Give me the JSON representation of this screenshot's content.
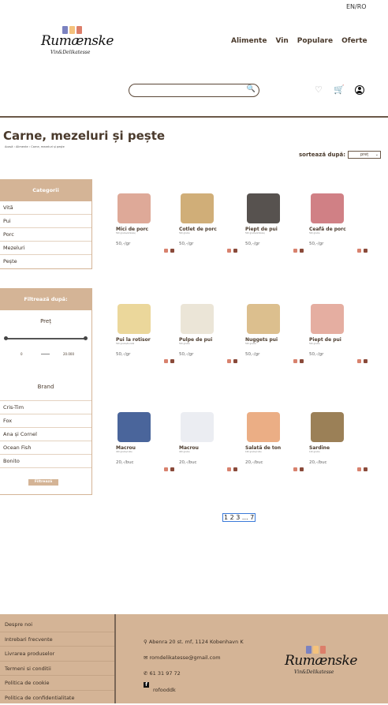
{
  "header": {
    "lang": "EN/RO",
    "logo_name": "Rumænske",
    "logo_sub": "Vin&Delikatesse",
    "nav": [
      "Alimente",
      "Vin",
      "Populare",
      "Oferte"
    ],
    "search_placeholder": "",
    "colors": {
      "bar1": "#7b82c0",
      "bar2": "#f4c27c",
      "bar3": "#dc7e6a",
      "accent": "#d4b496"
    }
  },
  "page": {
    "title": "Carne, mezeluri și pește",
    "breadcrumb": "Acasă › Alimente › Carne, mezeluri și pește",
    "sort_label": "sortează după:",
    "sort_value": "preț"
  },
  "categories": {
    "title": "Categorii",
    "items": [
      "Vită",
      "Pui",
      "Porc",
      "Mezeluri",
      "Pește"
    ]
  },
  "filter": {
    "title": "Filtrează după:",
    "price_label": "Preț",
    "price_min": "0",
    "price_max": "20.000",
    "price_range": [
      0,
      1
    ],
    "brand_label": "Brand",
    "brands": [
      "Cris-Tim",
      "Fox",
      "Ana și Cornel",
      "Ocean Fish",
      "Bonito"
    ],
    "button": "Filtrează"
  },
  "products": [
    {
      "name": "Mici de porc",
      "desc": "500 grame/ambalaj",
      "price": "50,-/gr",
      "color": "#d89a86"
    },
    {
      "name": "Cotlet de porc",
      "desc": "500 grame",
      "price": "50,-/gr",
      "color": "#c8a060"
    },
    {
      "name": "Piept de pui",
      "desc": "500 grame/ambalaj",
      "price": "50,-/gr",
      "color": "#3a3430"
    },
    {
      "name": "Ceafă de porc",
      "desc": "500 grame",
      "price": "50,-/gr",
      "color": "#c86a70"
    },
    {
      "name": "Pui la rotisor",
      "desc": "500 grame/bucată",
      "price": "50,-/gr",
      "color": "#e8d08a"
    },
    {
      "name": "Pulpe de pui",
      "desc": "500 grame",
      "price": "50,-/gr",
      "color": "#e8e0d0"
    },
    {
      "name": "Nuggets pui",
      "desc": "500 grame",
      "price": "50,-/gr",
      "color": "#d6b47a"
    },
    {
      "name": "Piept de pui",
      "desc": "500 grame",
      "price": "50,-/gr",
      "color": "#e0a090"
    },
    {
      "name": "Macrou",
      "desc": "400 grame/cutie",
      "price": "20,-/buc",
      "color": "#2a4a8a"
    },
    {
      "name": "Macrou",
      "desc": "400 grame",
      "price": "20,-/buc",
      "color": "#e8eaf0"
    },
    {
      "name": "Salată de ton",
      "desc": "160 grame/cutie",
      "price": "20,-/buc",
      "color": "#e8a070"
    },
    {
      "name": "Sardine",
      "desc": "120 grame",
      "price": "20,-/buc",
      "color": "#8a6a3a"
    }
  ],
  "pagination": "1 2 3 ... 7",
  "footer": {
    "links": [
      "Despre noi",
      "Intrebari frecvente",
      "Livrarea produselor",
      "Termeni si conditii",
      "Politica de cookie",
      "Politica de confidentialitate"
    ],
    "address": "Abenra 20 st. mf, 1124 Kobenhavn K",
    "email": "romdelikatesse@gmail.com",
    "phone": "61 31 97 72",
    "facebook": "rofooddk"
  }
}
